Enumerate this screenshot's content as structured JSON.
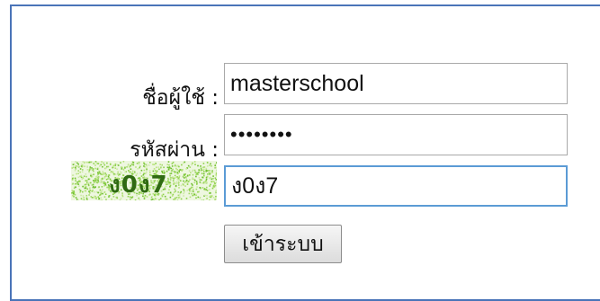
{
  "form": {
    "username_label": "ชื่อผู้ใช้ :",
    "username_value": "masterschool",
    "password_label": "รหัสผ่าน :",
    "password_value": "••••••••",
    "captcha_image_text": "ง0ง7",
    "captcha_value": "ง0ง7",
    "login_button_label": "เข้าระบบ"
  },
  "colors": {
    "frame_border": "#4a74b8",
    "focus_border": "#5b9bd5",
    "captcha_text": "#2f6a12",
    "captcha_noise": "#8ed14a"
  }
}
